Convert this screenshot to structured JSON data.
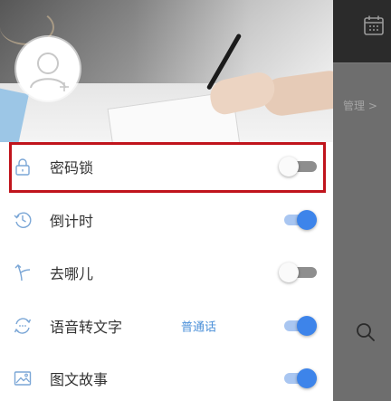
{
  "background": {
    "manage_link": "管理 >",
    "calendar_icon": "calendar-icon",
    "search_icon": "search-icon"
  },
  "drawer": {
    "avatar_icon": "add-user-avatar-icon",
    "accent_color": "#3d84ea",
    "highlight_color": "#c0141c",
    "items": [
      {
        "label": "密码锁",
        "icon": "lock-icon",
        "toggle": false,
        "highlighted": true
      },
      {
        "label": "倒计时",
        "icon": "clock-history-icon",
        "toggle": true
      },
      {
        "label": "去哪儿",
        "icon": "direction-arrow-icon",
        "toggle": false
      },
      {
        "label": "语音转文字",
        "icon": "voice-convert-icon",
        "extra": "普通话",
        "toggle": true
      },
      {
        "label": "图文故事",
        "icon": "image-icon",
        "toggle": true
      }
    ]
  }
}
